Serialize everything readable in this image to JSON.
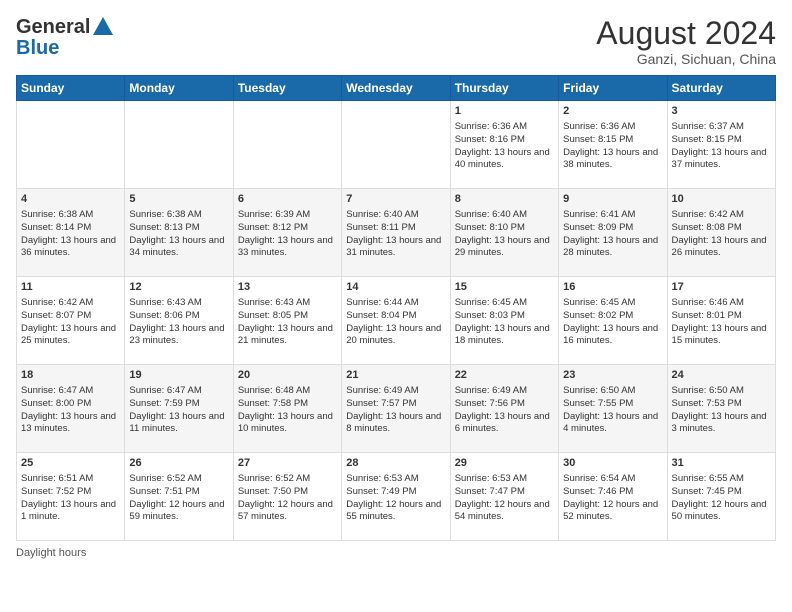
{
  "header": {
    "logo_general": "General",
    "logo_blue": "Blue",
    "month_year": "August 2024",
    "location": "Ganzi, Sichuan, China"
  },
  "days_of_week": [
    "Sunday",
    "Monday",
    "Tuesday",
    "Wednesday",
    "Thursday",
    "Friday",
    "Saturday"
  ],
  "footer": {
    "daylight_label": "Daylight hours"
  },
  "weeks": [
    {
      "days": [
        {
          "num": "",
          "info": ""
        },
        {
          "num": "",
          "info": ""
        },
        {
          "num": "",
          "info": ""
        },
        {
          "num": "",
          "info": ""
        },
        {
          "num": "1",
          "info": "Sunrise: 6:36 AM\nSunset: 8:16 PM\nDaylight: 13 hours and 40 minutes."
        },
        {
          "num": "2",
          "info": "Sunrise: 6:36 AM\nSunset: 8:15 PM\nDaylight: 13 hours and 38 minutes."
        },
        {
          "num": "3",
          "info": "Sunrise: 6:37 AM\nSunset: 8:15 PM\nDaylight: 13 hours and 37 minutes."
        }
      ]
    },
    {
      "days": [
        {
          "num": "4",
          "info": "Sunrise: 6:38 AM\nSunset: 8:14 PM\nDaylight: 13 hours and 36 minutes."
        },
        {
          "num": "5",
          "info": "Sunrise: 6:38 AM\nSunset: 8:13 PM\nDaylight: 13 hours and 34 minutes."
        },
        {
          "num": "6",
          "info": "Sunrise: 6:39 AM\nSunset: 8:12 PM\nDaylight: 13 hours and 33 minutes."
        },
        {
          "num": "7",
          "info": "Sunrise: 6:40 AM\nSunset: 8:11 PM\nDaylight: 13 hours and 31 minutes."
        },
        {
          "num": "8",
          "info": "Sunrise: 6:40 AM\nSunset: 8:10 PM\nDaylight: 13 hours and 29 minutes."
        },
        {
          "num": "9",
          "info": "Sunrise: 6:41 AM\nSunset: 8:09 PM\nDaylight: 13 hours and 28 minutes."
        },
        {
          "num": "10",
          "info": "Sunrise: 6:42 AM\nSunset: 8:08 PM\nDaylight: 13 hours and 26 minutes."
        }
      ]
    },
    {
      "days": [
        {
          "num": "11",
          "info": "Sunrise: 6:42 AM\nSunset: 8:07 PM\nDaylight: 13 hours and 25 minutes."
        },
        {
          "num": "12",
          "info": "Sunrise: 6:43 AM\nSunset: 8:06 PM\nDaylight: 13 hours and 23 minutes."
        },
        {
          "num": "13",
          "info": "Sunrise: 6:43 AM\nSunset: 8:05 PM\nDaylight: 13 hours and 21 minutes."
        },
        {
          "num": "14",
          "info": "Sunrise: 6:44 AM\nSunset: 8:04 PM\nDaylight: 13 hours and 20 minutes."
        },
        {
          "num": "15",
          "info": "Sunrise: 6:45 AM\nSunset: 8:03 PM\nDaylight: 13 hours and 18 minutes."
        },
        {
          "num": "16",
          "info": "Sunrise: 6:45 AM\nSunset: 8:02 PM\nDaylight: 13 hours and 16 minutes."
        },
        {
          "num": "17",
          "info": "Sunrise: 6:46 AM\nSunset: 8:01 PM\nDaylight: 13 hours and 15 minutes."
        }
      ]
    },
    {
      "days": [
        {
          "num": "18",
          "info": "Sunrise: 6:47 AM\nSunset: 8:00 PM\nDaylight: 13 hours and 13 minutes."
        },
        {
          "num": "19",
          "info": "Sunrise: 6:47 AM\nSunset: 7:59 PM\nDaylight: 13 hours and 11 minutes."
        },
        {
          "num": "20",
          "info": "Sunrise: 6:48 AM\nSunset: 7:58 PM\nDaylight: 13 hours and 10 minutes."
        },
        {
          "num": "21",
          "info": "Sunrise: 6:49 AM\nSunset: 7:57 PM\nDaylight: 13 hours and 8 minutes."
        },
        {
          "num": "22",
          "info": "Sunrise: 6:49 AM\nSunset: 7:56 PM\nDaylight: 13 hours and 6 minutes."
        },
        {
          "num": "23",
          "info": "Sunrise: 6:50 AM\nSunset: 7:55 PM\nDaylight: 13 hours and 4 minutes."
        },
        {
          "num": "24",
          "info": "Sunrise: 6:50 AM\nSunset: 7:53 PM\nDaylight: 13 hours and 3 minutes."
        }
      ]
    },
    {
      "days": [
        {
          "num": "25",
          "info": "Sunrise: 6:51 AM\nSunset: 7:52 PM\nDaylight: 13 hours and 1 minute."
        },
        {
          "num": "26",
          "info": "Sunrise: 6:52 AM\nSunset: 7:51 PM\nDaylight: 12 hours and 59 minutes."
        },
        {
          "num": "27",
          "info": "Sunrise: 6:52 AM\nSunset: 7:50 PM\nDaylight: 12 hours and 57 minutes."
        },
        {
          "num": "28",
          "info": "Sunrise: 6:53 AM\nSunset: 7:49 PM\nDaylight: 12 hours and 55 minutes."
        },
        {
          "num": "29",
          "info": "Sunrise: 6:53 AM\nSunset: 7:47 PM\nDaylight: 12 hours and 54 minutes."
        },
        {
          "num": "30",
          "info": "Sunrise: 6:54 AM\nSunset: 7:46 PM\nDaylight: 12 hours and 52 minutes."
        },
        {
          "num": "31",
          "info": "Sunrise: 6:55 AM\nSunset: 7:45 PM\nDaylight: 12 hours and 50 minutes."
        }
      ]
    }
  ]
}
